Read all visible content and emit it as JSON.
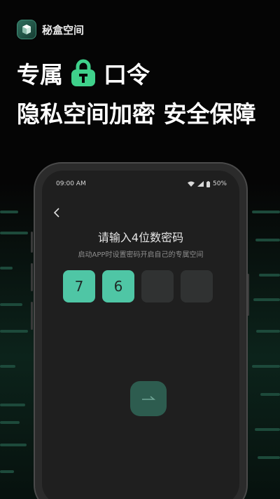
{
  "app": {
    "name": "秘盒空间",
    "logo_icon": "cube-icon"
  },
  "headline": {
    "line1_part1": "专属",
    "line1_part2": "口令",
    "line2": "隐私空间加密 安全保障",
    "lock_icon": "lock-icon",
    "accent_color": "#3fd18b"
  },
  "phone": {
    "status_time": "09:00 AM",
    "battery": "50%",
    "back_icon": "chevron-left-icon",
    "title": "请输入4位数密码",
    "subtitle": "启动APP时设置密码开启自己的专属空间",
    "pins": [
      "7",
      "6",
      "",
      ""
    ],
    "submit_icon": "arrow-right-icon",
    "pin_color": "#4fc6a5"
  }
}
